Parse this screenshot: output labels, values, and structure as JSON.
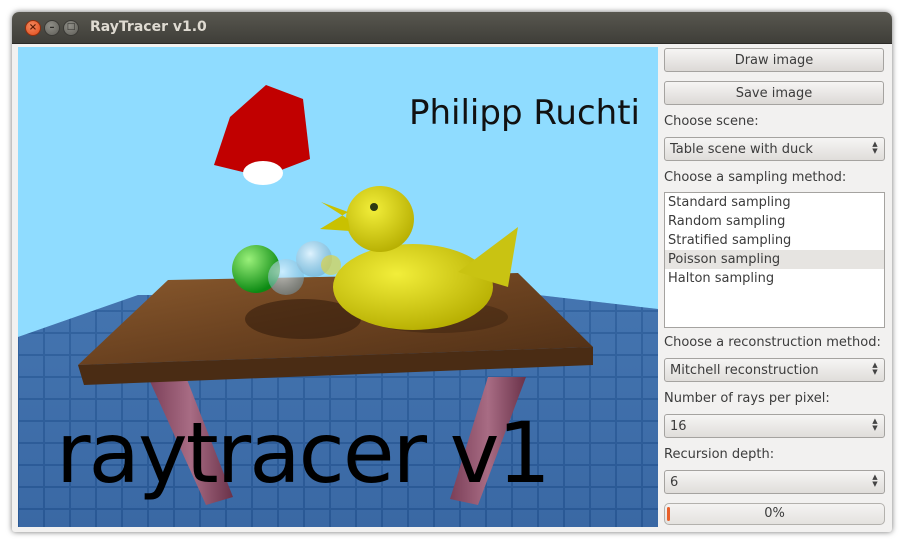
{
  "window": {
    "title": "RayTracer v1.0"
  },
  "render": {
    "author_text": "Philipp Ruchti",
    "banner_text": "raytracer v1"
  },
  "controls": {
    "draw_label": "Draw image",
    "save_label": "Save image",
    "scene_label": "Choose scene:",
    "scene_value": "Table scene with duck",
    "sampling_label": "Choose a sampling method:",
    "sampling_items": [
      "Standard sampling",
      "Random sampling",
      "Stratified sampling",
      "Poisson sampling",
      "Halton sampling"
    ],
    "sampling_selected": "Poisson sampling",
    "reconstruction_label": "Choose a reconstruction method:",
    "reconstruction_value": "Mitchell reconstruction",
    "rays_label": "Number of rays per pixel:",
    "rays_value": "16",
    "depth_label": "Recursion depth:",
    "depth_value": "6",
    "progress_text": "0%",
    "progress_value": 0.01
  },
  "colors": {
    "sky": "#8fdcff",
    "titlebar": "#4a4944",
    "close_button": "#e95420",
    "progress_fill": "#e8602b"
  }
}
